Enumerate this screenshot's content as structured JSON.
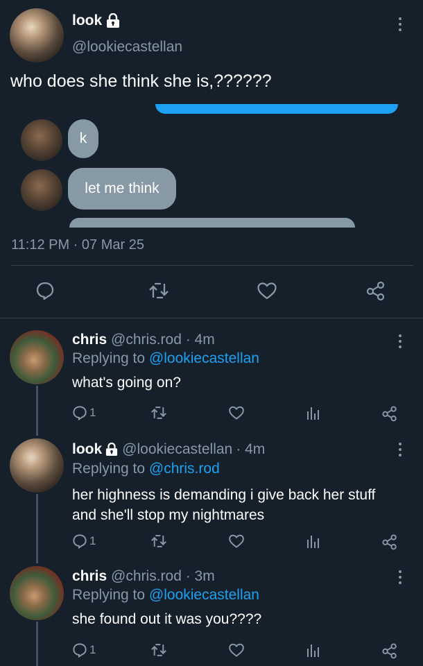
{
  "main_tweet": {
    "name": "look",
    "handle": "@lookiecastellan",
    "text": "who does she think she is,??????",
    "messages": [
      "k",
      "let me think"
    ],
    "timestamp": "11:12 PM · 07 Mar 25",
    "actions": [
      "reply-icon",
      "retweet-icon",
      "like-icon",
      "share-icon"
    ]
  },
  "replies": [
    {
      "name": "chris",
      "handle": "@chris.rod",
      "time": "· 4m",
      "replying_prefix": "Replying to",
      "replying_to": "@lookiecastellan",
      "text": "what's going on?",
      "reply_count": "1"
    },
    {
      "name": "look",
      "handle": "@lookiecastellan",
      "time": "· 4m",
      "replying_prefix": "Replying to",
      "replying_to": "@chris.rod",
      "text_line1": "her highness is demanding i give back her stuff",
      "text_line2": "and she'll stop my nightmares",
      "reply_count": "1"
    },
    {
      "name": "chris",
      "handle": "@chris.rod",
      "time": "· 3m",
      "replying_prefix": "Replying to",
      "replying_to": "@lookiecastellan",
      "text": "she found out it was you????",
      "reply_count": "1"
    }
  ],
  "colors": {
    "background": "#15202b",
    "accent": "#1da1f2",
    "muted": "#8899a6",
    "divider": "#38444d"
  }
}
